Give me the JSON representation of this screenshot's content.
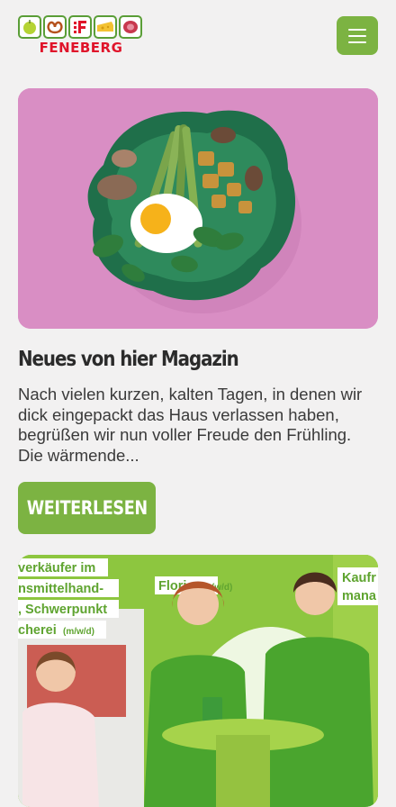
{
  "brand": {
    "name": "FENEBERG",
    "colors": {
      "green": "#7cb342",
      "red": "#e0142a"
    }
  },
  "header": {
    "menu_icon": "hamburger-menu-icon"
  },
  "article": {
    "title": "Neues von hier Magazin",
    "excerpt": "Nach vielen kurzen, kalten Tagen, in denen wir dick eingepackt das Haus verlassen haben, begrüßen wir nun voller Freude den Frühling. Die wärmende...",
    "read_more_label": "WEITERLESEN",
    "image_icon": "food-bowl-photo"
  },
  "job_teaser": {
    "sign_lines": [
      "verkäufer im",
      "nsmittelhand-",
      ", Schwerpunkt",
      "cherei",
      "(m/w/d)"
    ],
    "name_sign": "Flori",
    "name_sign_suffix": "(w/d)",
    "right_sign_lines": [
      "Kaufr",
      "mana"
    ],
    "image_icon": "staff-photo"
  }
}
